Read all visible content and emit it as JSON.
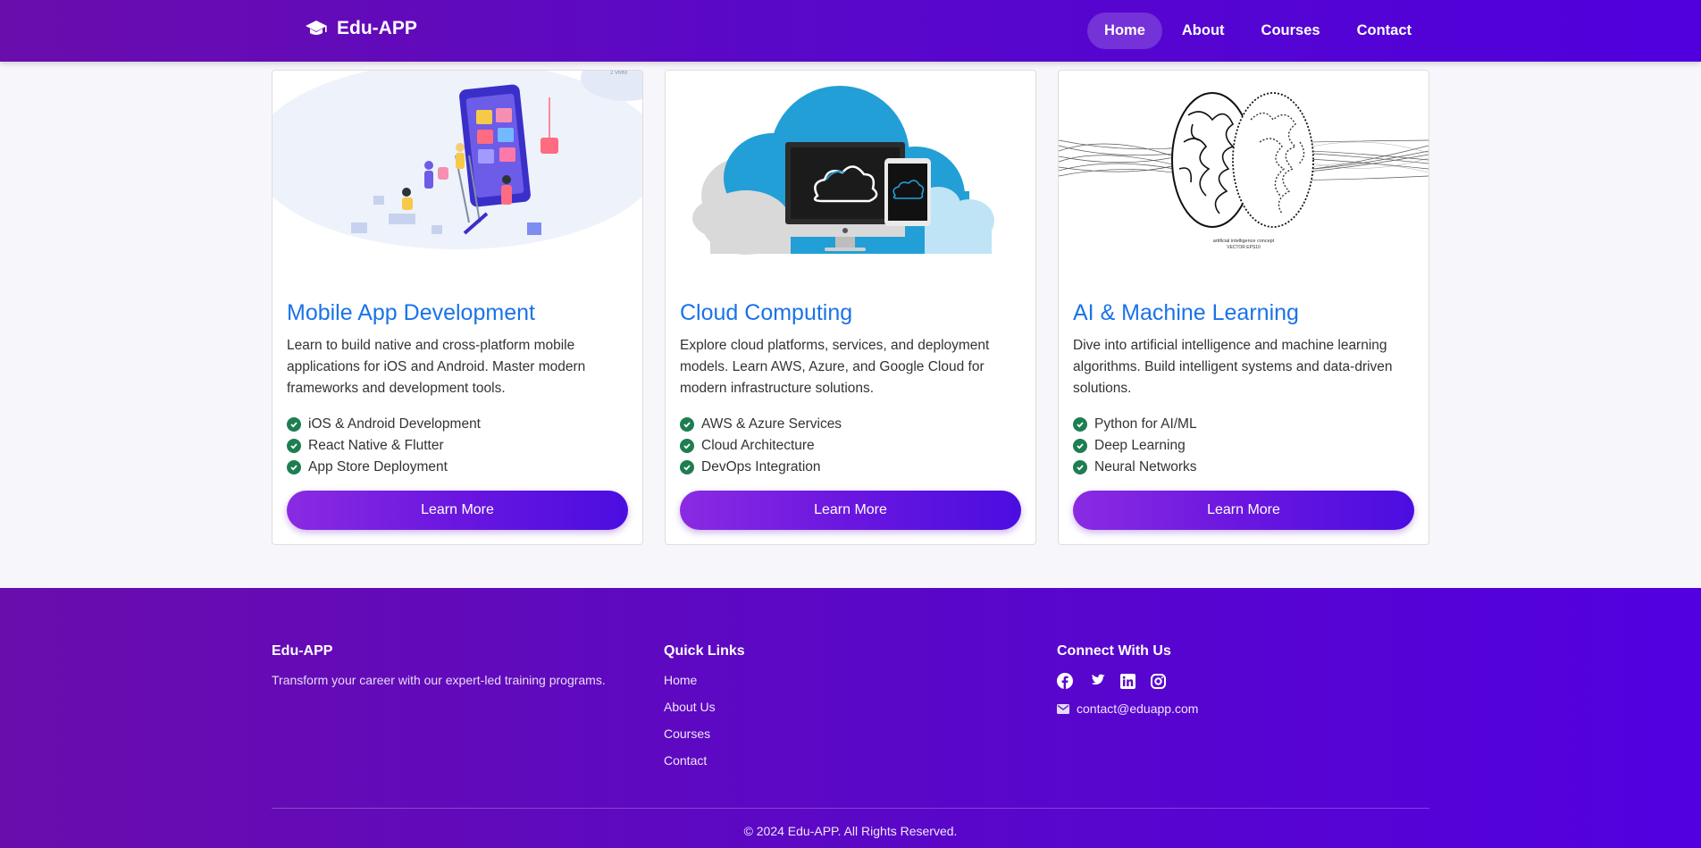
{
  "navbar": {
    "brand": "Edu-APP",
    "brand_icon": "graduation-cap-icon",
    "links": [
      {
        "label": "Home",
        "active": true
      },
      {
        "label": "About",
        "active": false
      },
      {
        "label": "Courses",
        "active": false
      },
      {
        "label": "Contact",
        "active": false
      }
    ]
  },
  "cards": [
    {
      "title": "Mobile App Development",
      "description": "Learn to build native and cross-platform mobile applications for iOS and Android. Master modern frameworks and development tools.",
      "features": [
        "iOS & Android Development",
        "React Native & Flutter",
        "App Store Deployment"
      ],
      "button": "Learn More"
    },
    {
      "title": "Cloud Computing",
      "description": "Explore cloud platforms, services, and deployment models. Learn AWS, Azure, and Google Cloud for modern infrastructure solutions.",
      "features": [
        "AWS & Azure Services",
        "Cloud Architecture",
        "DevOps Integration"
      ],
      "button": "Learn More"
    },
    {
      "title": "AI & Machine Learning",
      "description": "Dive into artificial intelligence and machine learning algorithms. Build intelligent systems and data-driven solutions.",
      "features": [
        "Python for AI/ML",
        "Deep Learning",
        "Neural Networks"
      ],
      "button": "Learn More",
      "image_caption": "artificial intelligence concept",
      "image_caption2": "VECTOR EPS10"
    }
  ],
  "footer": {
    "brand": "Edu-APP",
    "tagline": "Transform your career with our expert-led training programs.",
    "quick_links_title": "Quick Links",
    "quick_links": [
      "Home",
      "About Us",
      "Courses",
      "Contact"
    ],
    "connect_title": "Connect With Us",
    "socials": [
      "facebook-icon",
      "twitter-icon",
      "linkedin-icon",
      "instagram-icon"
    ],
    "email": "contact@eduapp.com",
    "copyright": "© 2024 Edu-APP. All Rights Reserved."
  },
  "colors": {
    "primary_purple": "#6a0dad",
    "accent_blue": "#1a73e8",
    "check_green": "#1e7e52"
  }
}
